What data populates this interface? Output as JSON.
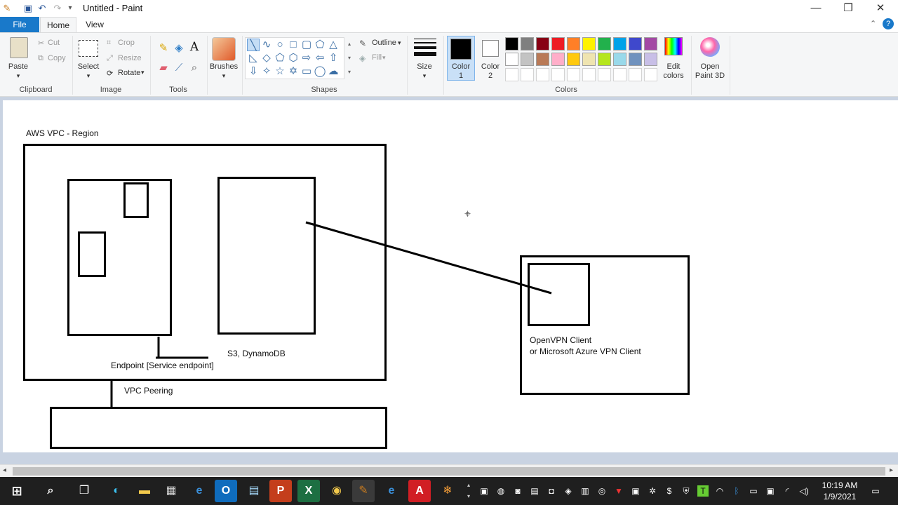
{
  "window": {
    "title": "Untitled - Paint",
    "minimize": "—",
    "restore": "❐",
    "close": "✕"
  },
  "tabs": {
    "file": "File",
    "home": "Home",
    "view": "View"
  },
  "clipboard": {
    "paste": "Paste",
    "cut": "Cut",
    "copy": "Copy",
    "label": "Clipboard"
  },
  "image": {
    "select": "Select",
    "crop": "Crop",
    "resize": "Resize",
    "rotate": "Rotate",
    "label": "Image"
  },
  "tools": {
    "label": "Tools"
  },
  "brushes": {
    "label": "Brushes"
  },
  "shapes": {
    "outline": "Outline",
    "fill": "Fill",
    "label": "Shapes"
  },
  "size": {
    "label": "Size"
  },
  "colors": {
    "color1": "Color",
    "color1_num": "1",
    "color2": "Color",
    "color2_num": "2",
    "edit": "Edit",
    "edit2": "colors",
    "paint3d": "Open",
    "paint3d2": "Paint 3D",
    "label": "Colors",
    "palette_row1": [
      "#000000",
      "#7f7f7f",
      "#880015",
      "#ed1c24",
      "#ff7f27",
      "#fff200",
      "#22b14c",
      "#00a2e8",
      "#3f48cc",
      "#a349a4"
    ],
    "palette_row2": [
      "#ffffff",
      "#c3c3c3",
      "#b97a57",
      "#ffaec9",
      "#ffc90e",
      "#efe4b0",
      "#b5e61d",
      "#99d9ea",
      "#7092be",
      "#c8bfe7"
    ]
  },
  "diagram": {
    "vpc_label": "AWS VPC - Region",
    "endpoint_label": "Endpoint [Service endpoint]",
    "s3_label": "S3, DynamoDB",
    "peering_label": "VPC Peering",
    "client_line1": "OpenVPN Client",
    "client_line2": "or Microsoft Azure VPN Client"
  },
  "taskbar": {
    "time": "10:19 AM",
    "date": "1/9/2021"
  }
}
